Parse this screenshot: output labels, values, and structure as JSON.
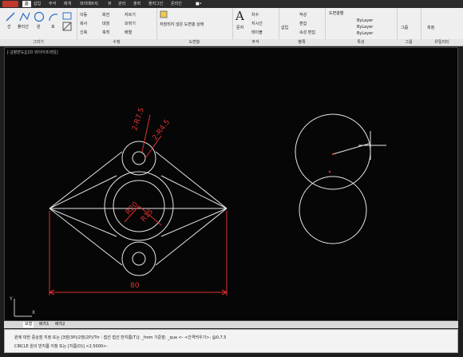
{
  "menu_tabs": [
    "홈",
    "삽입",
    "주석",
    "매개",
    "파라메트릭",
    "뷰",
    "관리",
    "출력",
    "플러그인",
    "온라인"
  ],
  "ribbon": {
    "draw": {
      "line": "선",
      "polyline": "폴리선",
      "circle": "원",
      "arc": "호",
      "label": "그리기"
    },
    "modify": {
      "move": "이동",
      "rotate": "회전",
      "trim": "자르기",
      "copy": "복사",
      "mirror": "대칭",
      "fillet": "모깎기",
      "stretch": "신축",
      "scale": "축척",
      "array": "배열",
      "label": "수정"
    },
    "layers": {
      "current": "저장되지 않은 도면층 상태",
      "label": "도면층"
    },
    "annotation": {
      "text": "문자",
      "dimension": "치수",
      "leader": "지시선",
      "table": "테이블",
      "label": "주석"
    },
    "block": {
      "insert": "삽입",
      "create": "작성",
      "edit": "편집",
      "attr": "속성 편집",
      "label": "블록"
    },
    "properties": {
      "color": "도면층별",
      "linetype1": "ByLayer",
      "linetype2": "ByLayer",
      "linetype3": "ByLayer",
      "match": "특성",
      "label": "특성"
    },
    "groups": {
      "group": "그룹",
      "label": "그룹"
    },
    "utilities": {
      "measure": "측정",
      "label": "유틸리티"
    }
  },
  "canvas": {
    "viewport": "[-][평면도][2D 와이어프레임]",
    "dims": {
      "r75": "2-R7.5",
      "r45": "2-R4.5",
      "r20": "R20",
      "r15": "R15",
      "d80": "80"
    }
  },
  "layout_tabs": [
    "모형",
    "배치1",
    "배치2"
  ],
  "command": {
    "history": "원에 대한 중심점 지정 또는 [3점(3P)/2점(2P)/Ttr - 접선 접선 반지름(T)]:  _from 기준점:  _qua <- <간격띄우기>: @0,7.5",
    "prompt": "CIRCLE 원의 반지름 지정 또는 [지름(D)] <2.5000>:"
  },
  "colors": {
    "accent": "#c0392b",
    "dimension": "#e03030",
    "geometry": "#e6e6e6"
  }
}
